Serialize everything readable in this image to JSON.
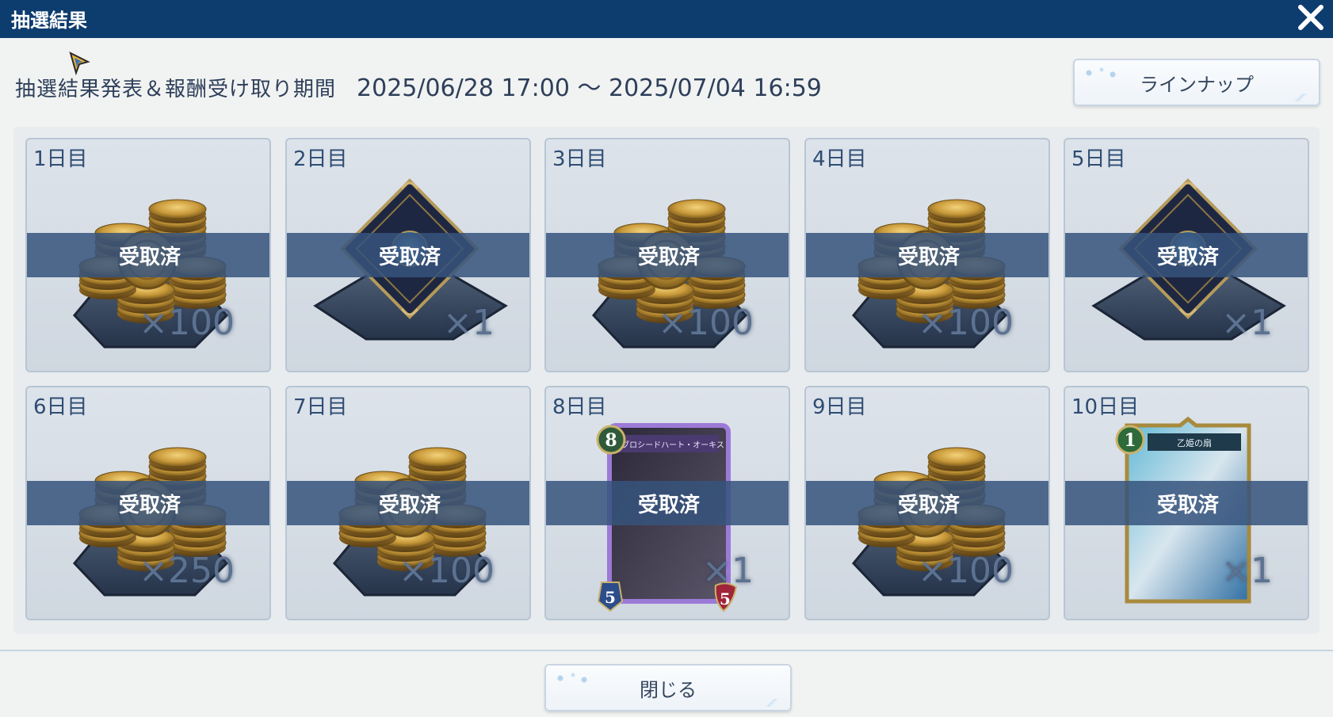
{
  "window": {
    "title": "抽選結果"
  },
  "header": {
    "period_label": "抽選結果発表＆報酬受け取り期間",
    "period_dates": "2025/06/28 17:00 ～ 2025/07/04 16:59",
    "lineup_label": "ラインナップ"
  },
  "rewards": [
    {
      "day": "1日目",
      "type": "coin",
      "qty": "×100",
      "status": "受取済"
    },
    {
      "day": "2日目",
      "type": "diamond",
      "qty": "×1",
      "status": "受取済"
    },
    {
      "day": "3日目",
      "type": "coin",
      "qty": "×100",
      "status": "受取済"
    },
    {
      "day": "4日目",
      "type": "coin",
      "qty": "×100",
      "status": "受取済"
    },
    {
      "day": "5日目",
      "type": "diamond",
      "qty": "×1",
      "status": "受取済"
    },
    {
      "day": "6日目",
      "type": "coin",
      "qty": "×250",
      "status": "受取済"
    },
    {
      "day": "7日目",
      "type": "coin",
      "qty": "×100",
      "status": "受取済"
    },
    {
      "day": "8日目",
      "type": "card",
      "qty": "×1",
      "status": "受取済",
      "card": {
        "cost": "8",
        "name": "ブロシードハート・オーキス",
        "attack": "5",
        "life": "5"
      }
    },
    {
      "day": "9日目",
      "type": "coin",
      "qty": "×100",
      "status": "受取済"
    },
    {
      "day": "10日目",
      "type": "card",
      "qty": "×1",
      "status": "受取済",
      "card": {
        "cost": "1",
        "name": "乙姫の扇"
      }
    }
  ],
  "footer": {
    "close_label": "閉じる"
  },
  "colors": {
    "titlebar": "#0d3c6e",
    "band": "#36547c",
    "background": "#f1f3f2"
  }
}
